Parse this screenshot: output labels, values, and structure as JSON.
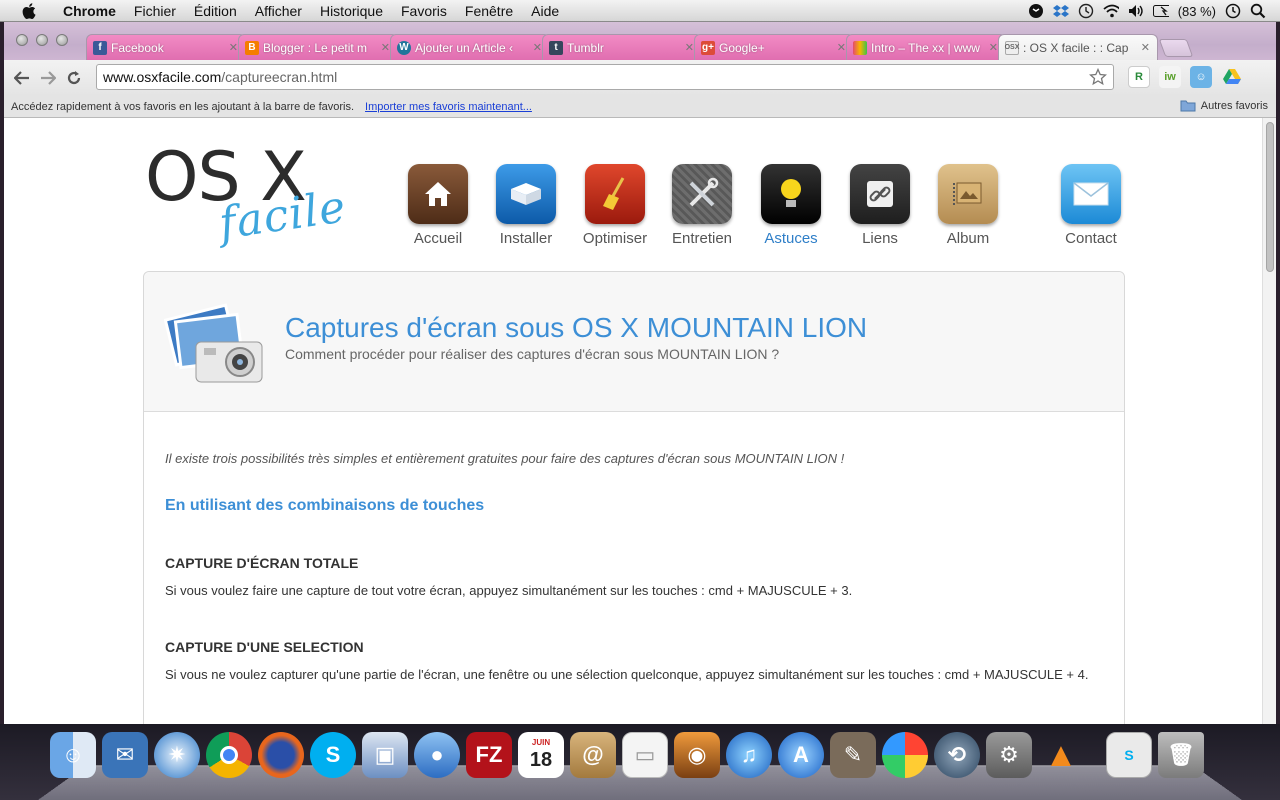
{
  "menubar": {
    "app_name": "Chrome",
    "items": [
      "Fichier",
      "Édition",
      "Afficher",
      "Historique",
      "Favoris",
      "Fenêtre",
      "Aide"
    ],
    "battery": "(83 %)"
  },
  "tabs": [
    {
      "title": "Facebook",
      "favicon": "facebook-icon",
      "color": "#3b5998",
      "pink": true
    },
    {
      "title": "Blogger : Le petit m",
      "favicon": "blogger-icon",
      "color": "#f57d00",
      "pink": true
    },
    {
      "title": "Ajouter un Article ‹",
      "favicon": "wordpress-icon",
      "color": "#21759b",
      "pink": true
    },
    {
      "title": "Tumblr",
      "favicon": "tumblr-icon",
      "color": "#35465c",
      "pink": true
    },
    {
      "title": "Google+",
      "favicon": "google-plus-icon",
      "color": "#dd4b39",
      "pink": true
    },
    {
      "title": "Intro – The xx | www",
      "favicon": "deezer-icon",
      "color": "#e54b6c",
      "pink": true
    },
    {
      "title": ": OS X facile : : Cap",
      "favicon": "osx-favicon",
      "color": "#888888",
      "pink": false,
      "active": true
    }
  ],
  "address_bar": {
    "host": "www.osxfacile.com",
    "path": "/captureecran.html"
  },
  "bookmarks_bar": {
    "message": "Accédez rapidement à vos favoris en les ajoutant à la barre de favoris.",
    "import_link": "Importer mes favoris maintenant...",
    "other_bookmarks": "Autres favoris"
  },
  "site": {
    "logo_main": "OS X",
    "logo_sub": "facile",
    "nav": [
      {
        "label": "Accueil",
        "icon": "home-icon"
      },
      {
        "label": "Installer",
        "icon": "installer-icon"
      },
      {
        "label": "Optimiser",
        "icon": "broom-icon"
      },
      {
        "label": "Entretien",
        "icon": "tools-icon"
      },
      {
        "label": "Astuces",
        "icon": "lightbulb-icon",
        "active": true
      },
      {
        "label": "Liens",
        "icon": "link-icon"
      },
      {
        "label": "Album",
        "icon": "album-icon"
      },
      {
        "label": "Contact",
        "icon": "mail-icon"
      }
    ]
  },
  "article": {
    "title": "Captures d'écran sous OS X MOUNTAIN LION",
    "subtitle": "Comment procéder pour réaliser des captures d'écran sous MOUNTAIN LION ?",
    "intro": "Il existe trois possibilités très simples et entièrement gratuites pour faire des captures d'écran sous MOUNTAIN LION !",
    "section_heading": "En utilisant des combinaisons de touches",
    "sub1_heading": "CAPTURE D'ÉCRAN TOTALE",
    "sub1_text": "Si vous voulez faire une capture de tout votre écran, appuyez simultanément sur les touches : cmd + MAJUSCULE + 3.",
    "sub2_heading": "CAPTURE D'UNE SELECTION",
    "sub2_text": "Si vous ne voulez capturer qu'une partie de l'écran, une fenêtre ou une sélection quelconque, appuyez simultanément sur les touches : cmd + MAJUSCULE + 4."
  },
  "dock": {
    "calendar_month": "JUIN",
    "calendar_day": "18"
  },
  "colors": {
    "accent_blue": "#3d8fd6",
    "tab_pink": "#e06eb0"
  }
}
